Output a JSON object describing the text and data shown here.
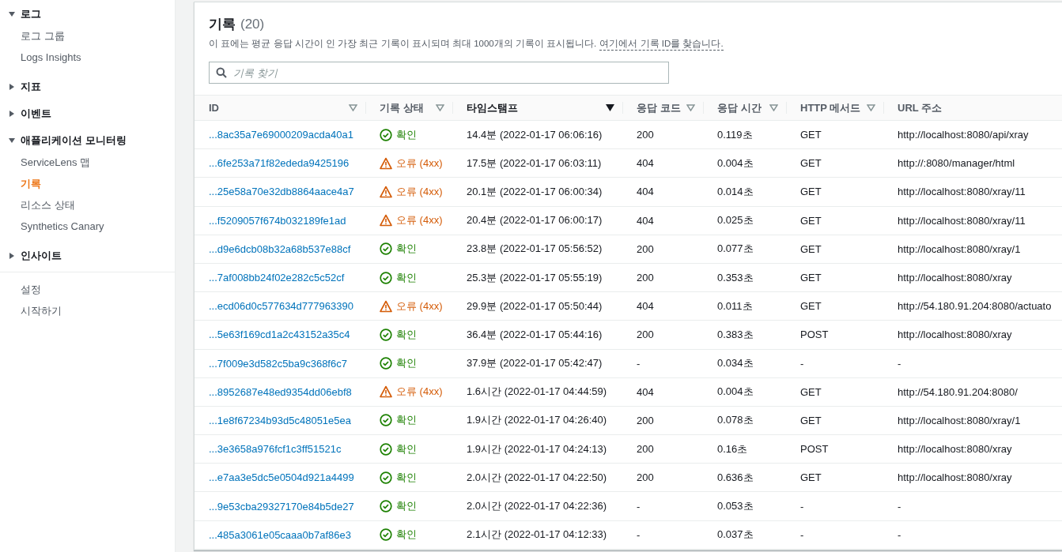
{
  "sidebar": {
    "groups": [
      {
        "label": "로그",
        "expanded": true,
        "items": [
          {
            "label": "로그 그룹",
            "selected": false
          },
          {
            "label": "Logs Insights",
            "selected": false
          }
        ]
      },
      {
        "label": "지표",
        "expanded": false
      },
      {
        "label": "이벤트",
        "expanded": false
      },
      {
        "label": "애플리케이션 모니터링",
        "expanded": true,
        "items": [
          {
            "label": "ServiceLens 맵",
            "selected": false
          },
          {
            "label": "기록",
            "selected": true
          },
          {
            "label": "리소스 상태",
            "selected": false
          },
          {
            "label": "Synthetics Canary",
            "selected": false
          }
        ]
      },
      {
        "label": "인사이트",
        "expanded": false
      }
    ],
    "footer_items": [
      {
        "label": "설정",
        "selected": false
      },
      {
        "label": "시작하기",
        "selected": false
      }
    ]
  },
  "panel": {
    "title": "기록",
    "count": "(20)",
    "description": "이 표에는 평균 응답 시간이 인 가장 최근 기록이 표시되며 최대 1000개의 기록이 표시됩니다.",
    "help_link": "여기에서 기록 ID를 찾습니다.",
    "search": {
      "placeholder": "기록 찾기"
    }
  },
  "table": {
    "columns": [
      {
        "label": "ID",
        "sortable": true,
        "sorted": false
      },
      {
        "label": "기록 상태",
        "sortable": true,
        "sorted": false
      },
      {
        "label": "타임스탬프",
        "sortable": true,
        "sorted": true
      },
      {
        "label": "응답 코드",
        "sortable": true,
        "sorted": false
      },
      {
        "label": "응답 시간",
        "sortable": true,
        "sorted": false
      },
      {
        "label": "HTTP 메서드",
        "sortable": true,
        "sorted": false
      },
      {
        "label": "URL 주소",
        "sortable": false,
        "sorted": false
      }
    ],
    "rows": [
      {
        "id": "...8ac35a7e69000209acda40a1",
        "status": "확인",
        "kind": "ok",
        "timestamp": "14.4분 (2022-01-17 06:06:16)",
        "code": "200",
        "time": "0.119초",
        "method": "GET",
        "url": "http://localhost:8080/api/xray"
      },
      {
        "id": "...6fe253a71f82ededa9425196",
        "status": "오류 (4xx)",
        "kind": "error",
        "timestamp": "17.5분 (2022-01-17 06:03:11)",
        "code": "404",
        "time": "0.004초",
        "method": "GET",
        "url": "http://:8080/manager/html"
      },
      {
        "id": "...25e58a70e32db8864aace4a7",
        "status": "오류 (4xx)",
        "kind": "error",
        "timestamp": "20.1분 (2022-01-17 06:00:34)",
        "code": "404",
        "time": "0.014초",
        "method": "GET",
        "url": "http://localhost:8080/xray/11"
      },
      {
        "id": "...f5209057f674b032189fe1ad",
        "status": "오류 (4xx)",
        "kind": "error",
        "timestamp": "20.4분 (2022-01-17 06:00:17)",
        "code": "404",
        "time": "0.025초",
        "method": "GET",
        "url": "http://localhost:8080/xray/11"
      },
      {
        "id": "...d9e6dcb08b32a68b537e88cf",
        "status": "확인",
        "kind": "ok",
        "timestamp": "23.8분 (2022-01-17 05:56:52)",
        "code": "200",
        "time": "0.077초",
        "method": "GET",
        "url": "http://localhost:8080/xray/1"
      },
      {
        "id": "...7af008bb24f02e282c5c52cf",
        "status": "확인",
        "kind": "ok",
        "timestamp": "25.3분 (2022-01-17 05:55:19)",
        "code": "200",
        "time": "0.353초",
        "method": "GET",
        "url": "http://localhost:8080/xray"
      },
      {
        "id": "...ecd06d0c577634d777963390",
        "status": "오류 (4xx)",
        "kind": "error",
        "timestamp": "29.9분 (2022-01-17 05:50:44)",
        "code": "404",
        "time": "0.011초",
        "method": "GET",
        "url": "http://54.180.91.204:8080/actuato"
      },
      {
        "id": "...5e63f169cd1a2c43152a35c4",
        "status": "확인",
        "kind": "ok",
        "timestamp": "36.4분 (2022-01-17 05:44:16)",
        "code": "200",
        "time": "0.383초",
        "method": "POST",
        "url": "http://localhost:8080/xray"
      },
      {
        "id": "...7f009e3d582c5ba9c368f6c7",
        "status": "확인",
        "kind": "ok",
        "timestamp": "37.9분 (2022-01-17 05:42:47)",
        "code": "-",
        "time": "0.034초",
        "method": "-",
        "url": "-"
      },
      {
        "id": "...8952687e48ed9354dd06ebf8",
        "status": "오류 (4xx)",
        "kind": "error",
        "timestamp": "1.6시간 (2022-01-17 04:44:59)",
        "code": "404",
        "time": "0.004초",
        "method": "GET",
        "url": "http://54.180.91.204:8080/"
      },
      {
        "id": "...1e8f67234b93d5c48051e5ea",
        "status": "확인",
        "kind": "ok",
        "timestamp": "1.9시간 (2022-01-17 04:26:40)",
        "code": "200",
        "time": "0.078초",
        "method": "GET",
        "url": "http://localhost:8080/xray/1"
      },
      {
        "id": "...3e3658a976fcf1c3ff51521c",
        "status": "확인",
        "kind": "ok",
        "timestamp": "1.9시간 (2022-01-17 04:24:13)",
        "code": "200",
        "time": "0.16초",
        "method": "POST",
        "url": "http://localhost:8080/xray"
      },
      {
        "id": "...e7aa3e5dc5e0504d921a4499",
        "status": "확인",
        "kind": "ok",
        "timestamp": "2.0시간 (2022-01-17 04:22:50)",
        "code": "200",
        "time": "0.636초",
        "method": "GET",
        "url": "http://localhost:8080/xray"
      },
      {
        "id": "...9e53cba29327170e84b5de27",
        "status": "확인",
        "kind": "ok",
        "timestamp": "2.0시간 (2022-01-17 04:22:36)",
        "code": "-",
        "time": "0.053초",
        "method": "-",
        "url": "-"
      },
      {
        "id": "...485a3061e05caaa0b7af86e3",
        "status": "확인",
        "kind": "ok",
        "timestamp": "2.1시간 (2022-01-17 04:12:33)",
        "code": "-",
        "time": "0.037초",
        "method": "-",
        "url": "-"
      }
    ]
  }
}
